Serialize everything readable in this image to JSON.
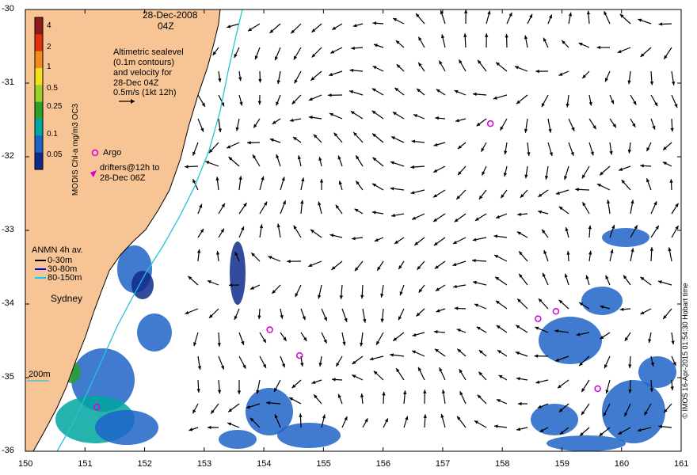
{
  "header": {
    "date": "28-Dec-2008",
    "time": "04Z"
  },
  "colorbar": {
    "label": "MODIS Chl-a mg/m3 OC3",
    "ticks": [
      "4",
      "2",
      "1",
      "0.5",
      "0.25",
      "0.1",
      "0.05"
    ],
    "colors": [
      "#8b1a1a",
      "#e03010",
      "#f08c1e",
      "#f2e020",
      "#9ad02a",
      "#2ca02c",
      "#00a6a0",
      "#1e64c8",
      "#102a8c"
    ]
  },
  "annotation": {
    "title": "Altimetric sealevel",
    "line2": "(0.1m contours)",
    "line3": "and velocity for",
    "line4": "28-Dec 04Z",
    "scale": "0.5m/s (1kt 12h)"
  },
  "legend": {
    "argo": "Argo",
    "drifters_line1": "drifters@12h to",
    "drifters_line2": "28-Dec 06Z",
    "argo_color": "#d400d4"
  },
  "anmn": {
    "title": "ANMN 4h av.",
    "items": [
      {
        "label": "0-30m",
        "color": "#000000"
      },
      {
        "label": "30-80m",
        "color": "#0000ff"
      },
      {
        "label": "80-150m",
        "color": "#00d0ff"
      }
    ]
  },
  "place": {
    "city": "Sydney",
    "isobath": "200m"
  },
  "credit": "© IMOS 16-Apr-2015 01:54:30 Hobart time",
  "axes": {
    "x_ticks": [
      "150",
      "151",
      "152",
      "153",
      "154",
      "155",
      "156",
      "157",
      "158",
      "159",
      "160",
      "161"
    ],
    "y_ticks": [
      "-30",
      "-31",
      "-32",
      "-33",
      "-34",
      "-35",
      "-36"
    ]
  },
  "colors": {
    "land": "#f7c595",
    "coast": "#000000",
    "isobath": "#22c4d6",
    "chl_low": "#1e64c8",
    "chl_mid": "#00a6a0"
  },
  "argo_floats": [
    {
      "lon": 157.8,
      "lat": -31.55
    },
    {
      "lon": 154.1,
      "lat": -34.35
    },
    {
      "lon": 154.6,
      "lat": -34.7
    },
    {
      "lon": 158.6,
      "lat": -34.2
    },
    {
      "lon": 158.9,
      "lat": -34.1
    },
    {
      "lon": 159.6,
      "lat": -35.15
    },
    {
      "lon": 151.2,
      "lat": -35.4
    }
  ]
}
